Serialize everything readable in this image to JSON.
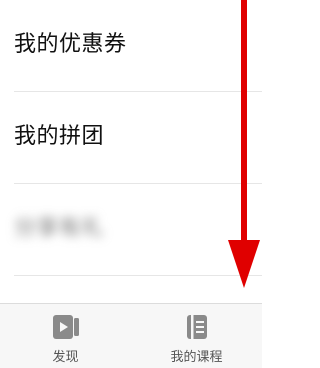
{
  "menu": {
    "items": [
      {
        "label": "我的优惠券"
      },
      {
        "label": "我的拼团"
      },
      {
        "label": "分享有礼"
      }
    ]
  },
  "tabbar": {
    "tabs": [
      {
        "label": "发现",
        "icon": "play-icon"
      },
      {
        "label": "我的课程",
        "icon": "book-icon"
      }
    ]
  },
  "colors": {
    "annotation_arrow": "#e00000",
    "divider": "#e6e6e6",
    "tab_icon": "#8a8a8a"
  }
}
